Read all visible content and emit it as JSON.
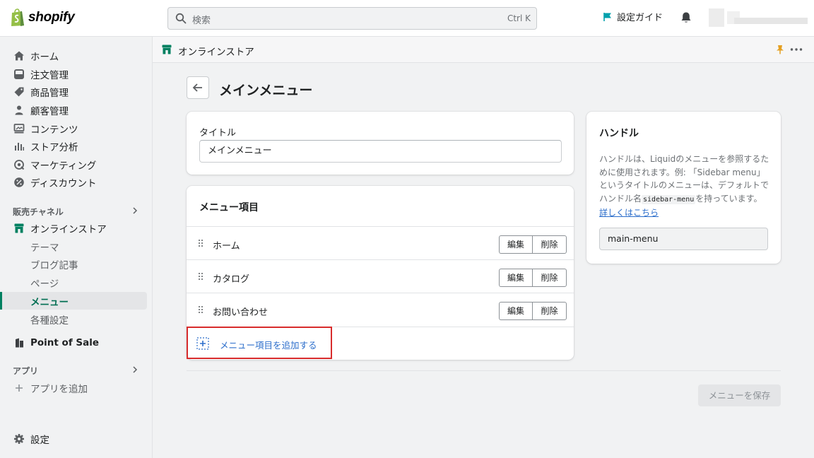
{
  "topbar": {
    "logo_text": "shopify",
    "search_placeholder": "検索",
    "search_shortcut": "Ctrl K",
    "guide_label": "設定ガイド"
  },
  "sidebar": {
    "items": [
      {
        "label": "ホーム",
        "icon": "home-icon"
      },
      {
        "label": "注文管理",
        "icon": "orders-icon"
      },
      {
        "label": "商品管理",
        "icon": "tag-icon"
      },
      {
        "label": "顧客管理",
        "icon": "person-icon"
      },
      {
        "label": "コンテンツ",
        "icon": "content-icon"
      },
      {
        "label": "ストア分析",
        "icon": "analytics-icon"
      },
      {
        "label": "マーケティング",
        "icon": "marketing-icon"
      },
      {
        "label": "ディスカウント",
        "icon": "discount-icon"
      }
    ],
    "sales_channels_heading": "販売チャネル",
    "online_store": "オンラインストア",
    "online_store_sub": [
      "テーマ",
      "ブログ記事",
      "ページ",
      "メニュー",
      "各種設定"
    ],
    "active_sub": "メニュー",
    "pos": "Point of Sale",
    "apps_heading": "アプリ",
    "add_app": "アプリを追加",
    "settings": "設定"
  },
  "page_strip": {
    "title": "オンラインストア"
  },
  "main": {
    "page_title": "メインメニュー",
    "title_card": {
      "label": "タイトル",
      "value": "メインメニュー"
    },
    "menu_card": {
      "heading": "メニュー項目",
      "items": [
        {
          "label": "ホーム",
          "edit": "編集",
          "delete": "削除"
        },
        {
          "label": "カタログ",
          "edit": "編集",
          "delete": "削除"
        },
        {
          "label": "お問い合わせ",
          "edit": "編集",
          "delete": "削除"
        }
      ],
      "add_label": "メニュー項目を追加する"
    },
    "handle_card": {
      "title": "ハンドル",
      "desc_1": "ハンドルは、Liquidのメニューを参照するために使用されます。例: 「Sidebar menu」というタイトルのメニューは、デフォルトでハンドル名",
      "desc_code": "sidebar-menu",
      "desc_2": "を持っています。",
      "learn_more": "詳しくはこちら",
      "value": "main-menu"
    },
    "save_label": "メニューを保存"
  },
  "colors": {
    "brand_green": "#008060",
    "link_blue": "#2c6ecb",
    "highlight_red": "#d82c2c",
    "flag_teal": "#00a0ac",
    "pin_orange": "#e5a022"
  }
}
